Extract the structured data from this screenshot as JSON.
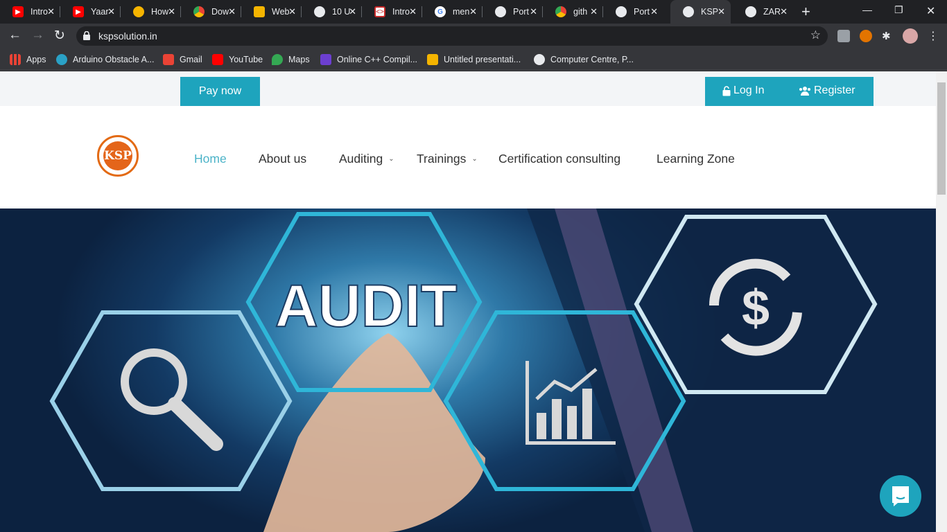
{
  "tabs": [
    {
      "title": "Intro",
      "icon": "youtube-icon",
      "color": "#ff0000"
    },
    {
      "title": "Yaar",
      "icon": "youtube-icon",
      "color": "#ff0000"
    },
    {
      "title": "How",
      "icon": "sun-icon",
      "color": "#f6b400"
    },
    {
      "title": "Dow",
      "icon": "chrome-icon",
      "color": "#4285f4"
    },
    {
      "title": "Web",
      "icon": "slides-icon",
      "color": "#f4b400"
    },
    {
      "title": "10 U",
      "icon": "globe-icon",
      "color": "#e8eaed"
    },
    {
      "title": "Intro",
      "icon": "code-icon",
      "color": "#c62828"
    },
    {
      "title": "men",
      "icon": "google-icon",
      "color": "#ffffff"
    },
    {
      "title": "Port",
      "icon": "globe-icon",
      "color": "#e8eaed"
    },
    {
      "title": "gith",
      "icon": "chrome-icon",
      "color": "#4285f4"
    },
    {
      "title": "Port",
      "icon": "globe-icon",
      "color": "#e8eaed"
    },
    {
      "title": "KSP",
      "icon": "globe-icon",
      "color": "#e8eaed",
      "active": true
    },
    {
      "title": "ZAR",
      "icon": "globe-icon",
      "color": "#e8eaed"
    }
  ],
  "address": {
    "url": "kspsolution.in"
  },
  "bookmarks": [
    {
      "label": "Apps",
      "icon": "apps-grid-icon",
      "color": "#ea4335"
    },
    {
      "label": "Arduino Obstacle A...",
      "icon": "arduino-icon",
      "color": "#2aa1c6"
    },
    {
      "label": "Gmail",
      "icon": "gmail-icon",
      "color": "#ea4335"
    },
    {
      "label": "YouTube",
      "icon": "youtube-icon",
      "color": "#ff0000"
    },
    {
      "label": "Maps",
      "icon": "maps-pin-icon",
      "color": "#34a853"
    },
    {
      "label": "Online C++ Compil...",
      "icon": "bolt-icon",
      "color": "#6c3fd1"
    },
    {
      "label": "Untitled presentati...",
      "icon": "slides-icon",
      "color": "#f4b400"
    },
    {
      "label": "Computer Centre, P...",
      "icon": "globe-icon",
      "color": "#e8eaed"
    }
  ],
  "site": {
    "pay_now": "Pay now",
    "login": "Log In",
    "register": "Register",
    "logo_text": "KSP",
    "accent_color": "#1ea4bd",
    "nav": [
      {
        "label": "Home",
        "active": true
      },
      {
        "label": "About us"
      },
      {
        "label": "Auditing",
        "dropdown": true
      },
      {
        "label": "Trainings",
        "dropdown": true
      },
      {
        "label": "Certification consulting"
      },
      {
        "label": "Learning Zone"
      }
    ],
    "hero": {
      "headline": "AUDIT",
      "currency_symbol": "$"
    }
  }
}
